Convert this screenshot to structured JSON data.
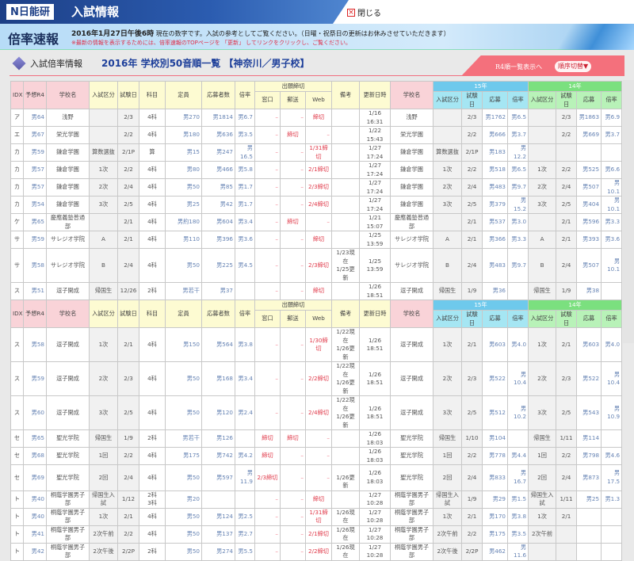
{
  "header": {
    "logo": "N日能研",
    "site_title": "入試情報",
    "close_label": "閉じる"
  },
  "banner": {
    "title": "倍率速報",
    "date": "2016年1月27日午後6時",
    "date_note": " 現在の数字です。入試の参考としてご覧ください。（日曜・祝祭日の更新はお休みさせていただきます）",
    "note": "※最新の情報を表示するためには、倍率速報のTOPページを 「更新」 してリンクをクリックし、ご覧ください。"
  },
  "titlebar": {
    "label": "入試倍率情報",
    "heading": "2016年 学校別50音順一覧 【神奈川／男子校】",
    "r4_link": "R4順一覧表示へ",
    "order_button": "順序切替▼"
  },
  "columns": {
    "main": [
      "IDX",
      "予想R4",
      "学校名",
      "入試区分",
      "試験日",
      "科目",
      "定員",
      "応募者数",
      "倍率"
    ],
    "deadline_group": "出願締切",
    "deadline": [
      "窓口",
      "郵送",
      "Web"
    ],
    "after": [
      "備考",
      "更新日時",
      "学校名"
    ],
    "y15": "15年",
    "y14": "14年",
    "prev": [
      "入試区分",
      "試験日",
      "応募",
      "倍率"
    ]
  },
  "colors": {
    "accent_red": "#e03a4a",
    "header_blue": "#1d3f86",
    "pink": "#f4707c"
  },
  "blocks": [
    {
      "rows": [
        [
          "ア",
          "男64",
          "浅野",
          "",
          "2/3",
          "4科",
          "男270",
          "男1814",
          "男6.7",
          "–",
          "–",
          "締切",
          "",
          "1/16 16:31",
          "浅野",
          "",
          "2/3",
          "男1762",
          "男6.5",
          "",
          "2/3",
          "男1863",
          "男6.9"
        ],
        [
          "エ",
          "男67",
          "栄光学園",
          "",
          "2/2",
          "4科",
          "男180",
          "男636",
          "男3.5",
          "–",
          "締切",
          "–",
          "",
          "1/22 15:43",
          "栄光学園",
          "",
          "2/2",
          "男666",
          "男3.7",
          "",
          "2/2",
          "男669",
          "男3.7"
        ],
        [
          "カ",
          "男59",
          "鎌倉学園",
          "算数選抜",
          "2/1P",
          "算",
          "男15",
          "男247",
          "男16.5",
          "–",
          "–",
          "1/31締切",
          "",
          "1/27 17:24",
          "鎌倉学園",
          "算数選抜",
          "2/1P",
          "男183",
          "男12.2",
          "",
          "",
          "",
          ""
        ],
        [
          "カ",
          "男57",
          "鎌倉学園",
          "1次",
          "2/2",
          "4科",
          "男80",
          "男466",
          "男5.8",
          "–",
          "–",
          "2/1締切",
          "",
          "1/27 17:24",
          "鎌倉学園",
          "1次",
          "2/2",
          "男518",
          "男6.5",
          "1次",
          "2/2",
          "男525",
          "男6.6"
        ],
        [
          "カ",
          "男57",
          "鎌倉学園",
          "2次",
          "2/4",
          "4科",
          "男50",
          "男85",
          "男1.7",
          "–",
          "–",
          "2/3締切",
          "",
          "1/27 17:24",
          "鎌倉学園",
          "2次",
          "2/4",
          "男483",
          "男9.7",
          "2次",
          "2/4",
          "男507",
          "男10.1"
        ],
        [
          "カ",
          "男54",
          "鎌倉学園",
          "3次",
          "2/5",
          "4科",
          "男25",
          "男42",
          "男1.7",
          "–",
          "–",
          "2/4締切",
          "",
          "1/27 17:24",
          "鎌倉学園",
          "3次",
          "2/5",
          "男379",
          "男15.2",
          "3次",
          "2/5",
          "男404",
          "男10.1"
        ],
        [
          "ケ",
          "男65",
          "慶應義塾普通部",
          "",
          "2/1",
          "4科",
          "男約180",
          "男604",
          "男3.4",
          "–",
          "締切",
          "–",
          "",
          "1/21 15:07",
          "慶應義塾普通部",
          "",
          "2/1",
          "男537",
          "男3.0",
          "",
          "2/1",
          "男596",
          "男3.3"
        ],
        [
          "サ",
          "男59",
          "サレジオ学院",
          "A",
          "2/1",
          "4科",
          "男110",
          "男396",
          "男3.6",
          "–",
          "–",
          "締切",
          "",
          "1/25 13:59",
          "サレジオ学院",
          "A",
          "2/1",
          "男366",
          "男3.3",
          "A",
          "2/1",
          "男393",
          "男3.6"
        ],
        [
          "サ",
          "男58",
          "サレジオ学院",
          "B",
          "2/4",
          "4科",
          "男50",
          "男225",
          "男4.5",
          "–",
          "–",
          "2/3締切",
          "1/23現在\n1/25更新",
          "1/25 13:59",
          "サレジオ学院",
          "B",
          "2/4",
          "男483",
          "男9.7",
          "B",
          "2/4",
          "男507",
          "男10.1"
        ],
        [
          "ス",
          "男51",
          "逗子開成",
          "帰国生",
          "12/26",
          "2科",
          "男若干",
          "男37",
          "",
          "–",
          "–",
          "締切",
          "",
          "1/26 18:51",
          "逗子開成",
          "帰国生",
          "1/9",
          "男36",
          "",
          "帰国生",
          "1/9",
          "男38",
          ""
        ]
      ]
    },
    {
      "rows": [
        [
          "ス",
          "男58",
          "逗子開成",
          "1次",
          "2/1",
          "4科",
          "男150",
          "男564",
          "男3.8",
          "–",
          "–",
          "1/30締切",
          "1/22現在\n1/26更新",
          "1/26 18:51",
          "逗子開成",
          "1次",
          "2/1",
          "男603",
          "男4.0",
          "1次",
          "2/1",
          "男603",
          "男4.0"
        ],
        [
          "ス",
          "男59",
          "逗子開成",
          "2次",
          "2/3",
          "4科",
          "男50",
          "男168",
          "男3.4",
          "–",
          "–",
          "2/2締切",
          "1/22現在\n1/26更新",
          "1/26 18:51",
          "逗子開成",
          "2次",
          "2/3",
          "男522",
          "男10.4",
          "2次",
          "2/3",
          "男522",
          "男10.4"
        ],
        [
          "ス",
          "男60",
          "逗子開成",
          "3次",
          "2/5",
          "4科",
          "男50",
          "男120",
          "男2.4",
          "–",
          "–",
          "2/4締切",
          "1/22現在\n1/26更新",
          "1/26 18:51",
          "逗子開成",
          "3次",
          "2/5",
          "男512",
          "男10.2",
          "3次",
          "2/5",
          "男543",
          "男10.9"
        ],
        [
          "セ",
          "男65",
          "聖光学院",
          "帰国生",
          "1/9",
          "2科",
          "男若干",
          "男126",
          "",
          "締切",
          "締切",
          "–",
          "",
          "1/26 18:03",
          "聖光学院",
          "帰国生",
          "1/10",
          "男104",
          "",
          "帰国生",
          "1/11",
          "男114",
          ""
        ],
        [
          "セ",
          "男68",
          "聖光学院",
          "1回",
          "2/2",
          "4科",
          "男175",
          "男742",
          "男4.2",
          "締切",
          "–",
          "–",
          "",
          "1/26 18:03",
          "聖光学院",
          "1回",
          "2/2",
          "男778",
          "男4.4",
          "1回",
          "2/2",
          "男798",
          "男4.6"
        ],
        [
          "セ",
          "男69",
          "聖光学院",
          "2回",
          "2/4",
          "4科",
          "男50",
          "男597",
          "男11.9",
          "2/3締切",
          "–",
          "–",
          "\n1/26更新",
          "1/26 18:03",
          "聖光学院",
          "2回",
          "2/4",
          "男833",
          "男16.7",
          "2回",
          "2/4",
          "男873",
          "男17.5"
        ],
        [
          "ト",
          "男40",
          "桐蔭学園男子部",
          "帰国生入試",
          "1/12",
          "2科\n3科",
          "男20",
          "",
          "",
          "–",
          "–",
          "締切",
          "",
          "1/27 10:28",
          "桐蔭学園男子部",
          "帰国生入試",
          "1/9",
          "男29",
          "男1.5",
          "帰国生入試",
          "1/11",
          "男25",
          "男1.3"
        ],
        [
          "ト",
          "男40",
          "桐蔭学園男子部",
          "1次",
          "2/1",
          "4科",
          "男50",
          "男124",
          "男2.5",
          "–",
          "–",
          "1/31締切",
          "1/26現在",
          "1/27 10:28",
          "桐蔭学園男子部",
          "1次",
          "2/1",
          "男170",
          "男3.8",
          "1次",
          "2/1",
          "",
          ""
        ],
        [
          "ト",
          "男41",
          "桐蔭学園男子部",
          "2次午前",
          "2/2",
          "4科",
          "男50",
          "男137",
          "男2.7",
          "–",
          "–",
          "2/1締切",
          "1/26現在",
          "1/27 10:28",
          "桐蔭学園男子部",
          "2次午前",
          "2/2",
          "男175",
          "男3.5",
          "2次午前",
          "",
          "",
          ""
        ],
        [
          "ト",
          "男42",
          "桐蔭学園男子部",
          "2次午後",
          "2/2P",
          "2科",
          "男50",
          "男274",
          "男5.5",
          "–",
          "–",
          "2/2締切",
          "1/26現在",
          "1/27 10:28",
          "桐蔭学園男子部",
          "2次午後",
          "2/2P",
          "男462",
          "男11.6",
          "",
          "",
          "",
          ""
        ]
      ]
    }
  ]
}
